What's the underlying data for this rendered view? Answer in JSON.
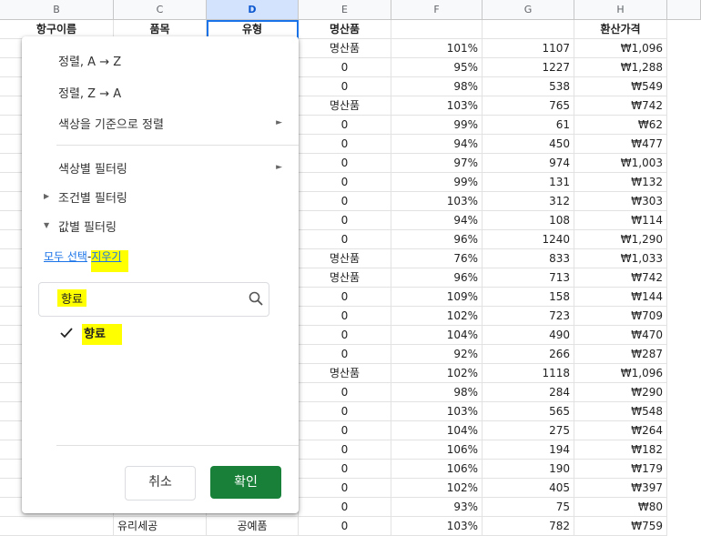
{
  "columns": [
    {
      "letter": "B"
    },
    {
      "letter": "C"
    },
    {
      "letter": "D"
    },
    {
      "letter": "E"
    },
    {
      "letter": "F"
    },
    {
      "letter": "G"
    },
    {
      "letter": "H"
    }
  ],
  "header_row": {
    "b": "항구이름",
    "c": "품목",
    "d": "유형",
    "e": "명산품",
    "f": "",
    "g": "",
    "h": "환산가격"
  },
  "rows": [
    {
      "e": "명산품",
      "f": "101%",
      "g": "1107",
      "h": "₩1,096"
    },
    {
      "e": "0",
      "f": "95%",
      "g": "1227",
      "h": "₩1,288"
    },
    {
      "e": "0",
      "f": "98%",
      "g": "538",
      "h": "₩549"
    },
    {
      "e": "명산품",
      "f": "103%",
      "g": "765",
      "h": "₩742"
    },
    {
      "e": "0",
      "f": "99%",
      "g": "61",
      "h": "₩62"
    },
    {
      "e": "0",
      "f": "94%",
      "g": "450",
      "h": "₩477"
    },
    {
      "e": "0",
      "f": "97%",
      "g": "974",
      "h": "₩1,003"
    },
    {
      "e": "0",
      "f": "99%",
      "g": "131",
      "h": "₩132"
    },
    {
      "e": "0",
      "f": "103%",
      "g": "312",
      "h": "₩303"
    },
    {
      "e": "0",
      "f": "94%",
      "g": "108",
      "h": "₩114"
    },
    {
      "e": "0",
      "f": "96%",
      "g": "1240",
      "h": "₩1,290"
    },
    {
      "e": "명산품",
      "f": "76%",
      "g": "833",
      "h": "₩1,033"
    },
    {
      "e": "명산품",
      "f": "96%",
      "g": "713",
      "h": "₩742"
    },
    {
      "e": "0",
      "f": "109%",
      "g": "158",
      "h": "₩144"
    },
    {
      "e": "0",
      "f": "102%",
      "g": "723",
      "h": "₩709"
    },
    {
      "e": "0",
      "f": "104%",
      "g": "490",
      "h": "₩470"
    },
    {
      "e": "0",
      "f": "92%",
      "g": "266",
      "h": "₩287"
    },
    {
      "e": "명산품",
      "f": "102%",
      "g": "1118",
      "h": "₩1,096"
    },
    {
      "e": "0",
      "f": "98%",
      "g": "284",
      "h": "₩290"
    },
    {
      "e": "0",
      "f": "103%",
      "g": "565",
      "h": "₩548"
    },
    {
      "e": "0",
      "f": "104%",
      "g": "275",
      "h": "₩264"
    },
    {
      "e": "0",
      "f": "106%",
      "g": "194",
      "h": "₩182"
    },
    {
      "e": "0",
      "f": "106%",
      "g": "190",
      "h": "₩179"
    },
    {
      "e": "0",
      "f": "102%",
      "g": "405",
      "h": "₩397"
    },
    {
      "e": "0",
      "f": "93%",
      "g": "75",
      "h": "₩80"
    },
    {
      "c": "유리세공",
      "d": "공예품",
      "e": "0",
      "f": "103%",
      "g": "782",
      "h": "₩759"
    }
  ],
  "popup": {
    "sort_az": "정렬, A → Z",
    "sort_za": "정렬, Z → A",
    "sort_color": "색상을 기준으로 정렬",
    "filter_color": "색상별 필터링",
    "filter_condition": "조건별 필터링",
    "filter_values": "값별 필터링",
    "select_all": "모두 선택",
    "separator": "-",
    "clear": "지우기",
    "search_value": "향료",
    "checked_item": "향료",
    "cancel": "취소",
    "ok": "확인"
  },
  "colors": {
    "highlight": "#ffff00",
    "ok_button": "#188038",
    "link": "#1a73e8",
    "selected_column": "#1a73e8"
  }
}
